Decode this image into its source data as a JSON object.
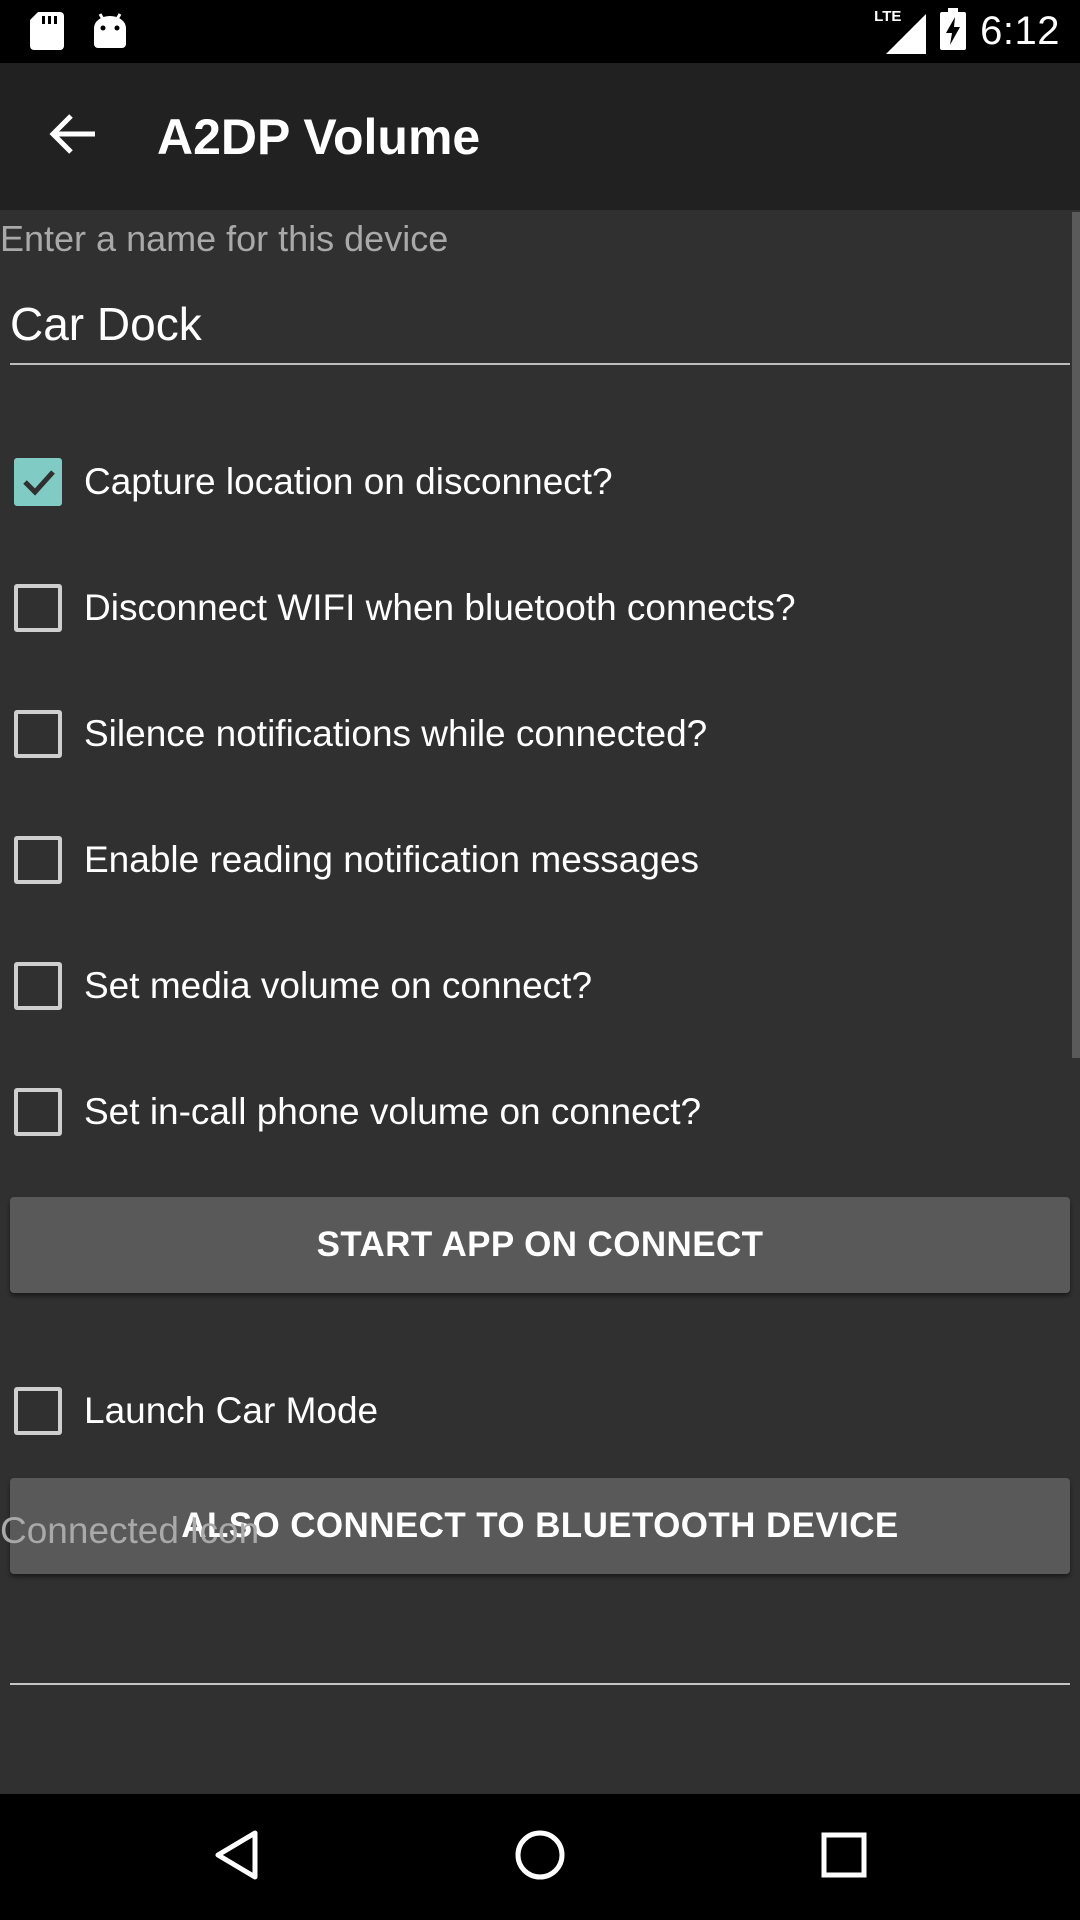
{
  "status_bar": {
    "time": "6:12",
    "network": "LTE",
    "icons": [
      "sd-card-icon",
      "android-icon",
      "signal-icon",
      "battery-charging-icon"
    ]
  },
  "app_bar": {
    "title": "A2DP Volume",
    "back_icon": "arrow-back-icon"
  },
  "form": {
    "name_label": "Enter a name for this device",
    "name_value": "Car Dock",
    "checkboxes": [
      {
        "label": "Capture location on disconnect?",
        "checked": true
      },
      {
        "label": "Disconnect WIFI when bluetooth connects?",
        "checked": false
      },
      {
        "label": "Silence notifications while connected?",
        "checked": false
      },
      {
        "label": "Enable reading notification messages",
        "checked": false
      },
      {
        "label": "Set media volume on connect?",
        "checked": false
      },
      {
        "label": "Set in-call phone volume on connect?",
        "checked": false
      }
    ],
    "start_app_button": "START APP ON CONNECT",
    "car_mode": {
      "label": "Launch Car Mode",
      "checked": false
    },
    "bluetooth_button": "ALSO CONNECT TO BLUETOOTH DEVICE",
    "connected_icon_label": "Connected Icon"
  },
  "colors": {
    "accent": "#80cbc4",
    "background": "#303030",
    "app_bar": "#212121",
    "button": "#595959"
  },
  "nav_bar": {
    "icons": [
      "back-triangle-icon",
      "home-circle-icon",
      "recents-square-icon"
    ]
  }
}
